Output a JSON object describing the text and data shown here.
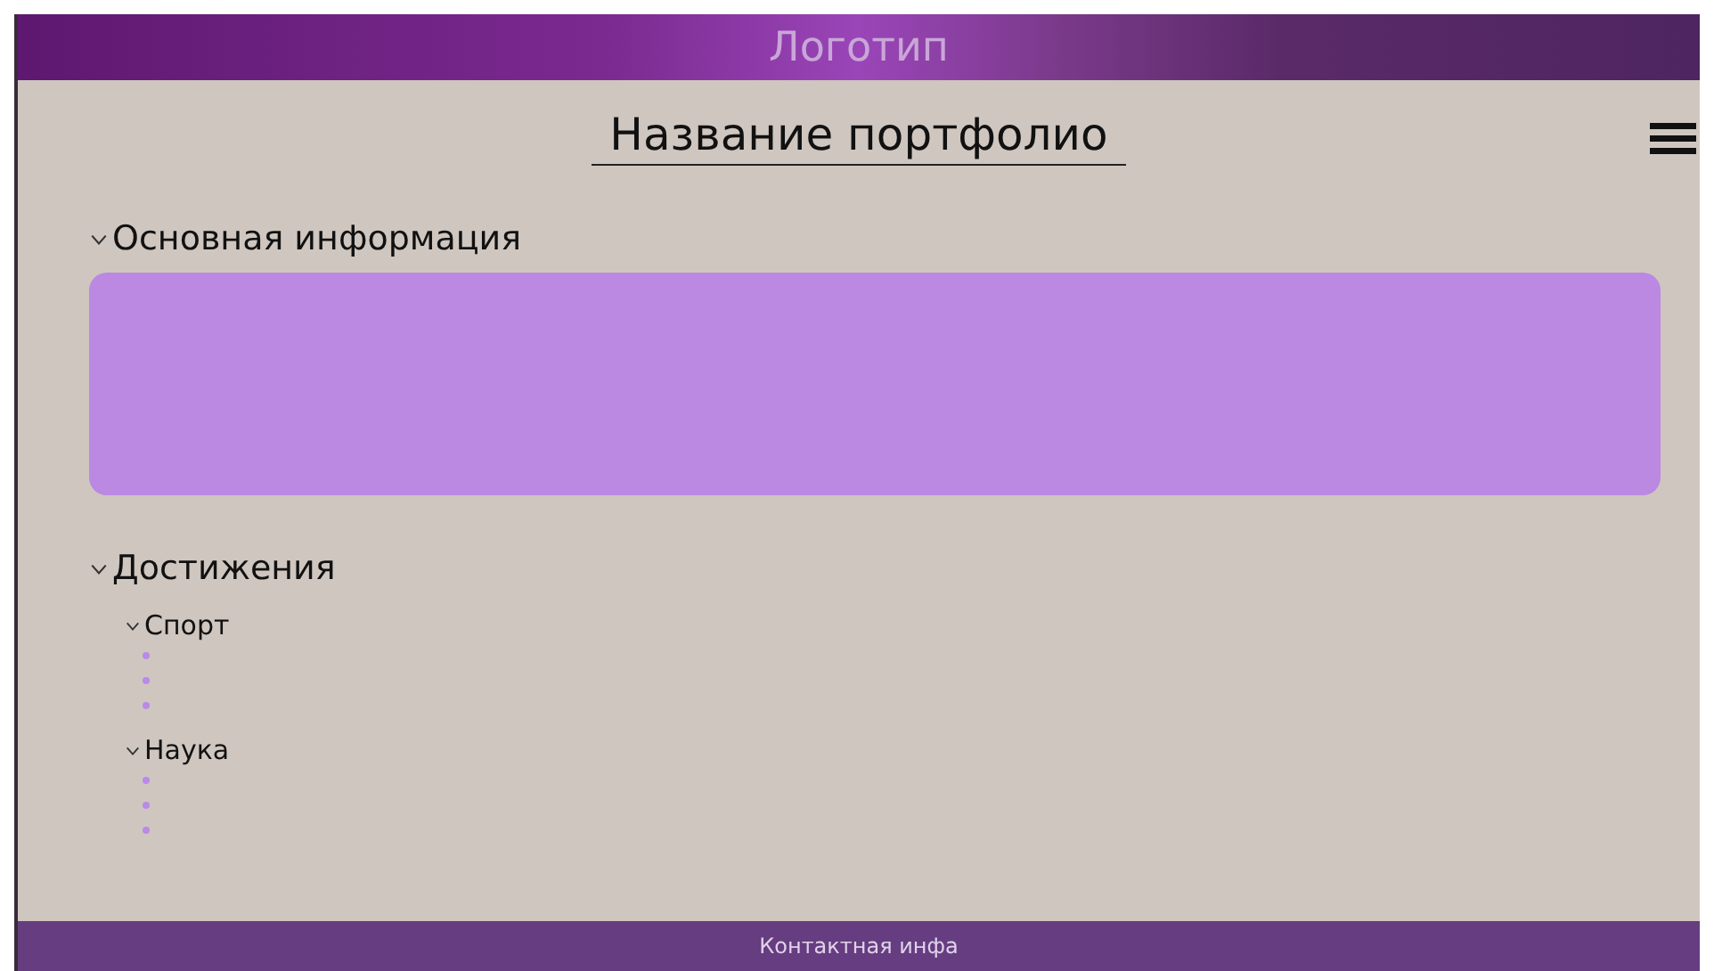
{
  "header": {
    "logo": "Логотип"
  },
  "title": "Название портфолио",
  "sections": [
    {
      "title": "Основная информация",
      "expanded": true,
      "kind": "card"
    },
    {
      "title": "Достижения",
      "expanded": true,
      "kind": "list",
      "children": [
        {
          "title": "Спорт",
          "expanded": true
        },
        {
          "title": "Наука",
          "expanded": true
        }
      ]
    }
  ],
  "footer": {
    "text": "Контактная инфа"
  }
}
